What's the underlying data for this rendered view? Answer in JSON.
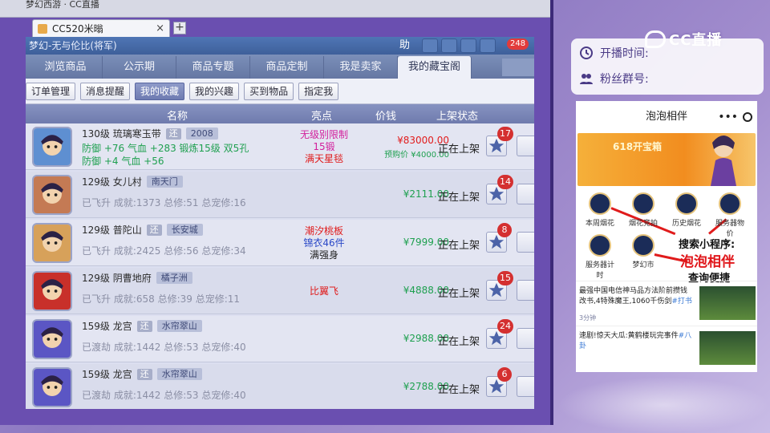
{
  "browser": {
    "top_text": "梦幻西游  ·  CC直播",
    "tab_label": "CC520米暡"
  },
  "app": {
    "title": "梦幻-无与伦比(将军)",
    "help_label": "助",
    "notification_count": "248",
    "nav_tabs": [
      "浏览商品",
      "公示期",
      "商品专题",
      "商品定制",
      "我是卖家",
      "我的藏宝阁"
    ],
    "active_tab_index": 5,
    "sub_buttons": [
      "订单管理",
      "消息提醒",
      "我的收藏",
      "我的兴趣",
      "买到物品",
      "指定我"
    ],
    "active_sub_index": 2,
    "columns": [
      "名称",
      "亮点",
      "价钱",
      "上架状态"
    ]
  },
  "rows": [
    {
      "level_name": "130级  琉璃寒玉带",
      "tag": "还",
      "server": "2008",
      "stats_line1": "防御 +76 气血 +283 锻炼15级 双5孔",
      "stats_line2": "防御 +4 气血 +56",
      "stats_green": true,
      "highlights": [
        {
          "text": "无级别限制",
          "color": "#d21f9c"
        },
        {
          "text": "15锻",
          "color": "#d21f9c"
        },
        {
          "text": "满天星毯",
          "color": "#e01b1b"
        }
      ],
      "price": "¥83000.00",
      "price_red": true,
      "price_sub": "预购价 ¥4000.00",
      "status": "正在上架",
      "fav_count": "17",
      "avatar_color": "#5e8fd1"
    },
    {
      "level_name": "129级  女儿村",
      "tag": "",
      "server": "南天门",
      "stats_line1": "已飞升 成就:1373 总修:51 总宠修:16",
      "stats_line2": "",
      "stats_green": false,
      "highlights": [],
      "price": "¥2111.00",
      "price_red": false,
      "price_sub": "",
      "status": "正在上架",
      "fav_count": "14",
      "avatar_color": "#c47a54"
    },
    {
      "level_name": "129级  普陀山",
      "tag": "还",
      "server": "长安城",
      "stats_line1": "已飞升 成就:2425 总修:56 总宠修:34",
      "stats_line2": "",
      "stats_green": false,
      "highlights": [
        {
          "text": "潮汐桃板",
          "color": "#e01b1b"
        },
        {
          "text": "锦衣46件",
          "color": "#2a48c7"
        },
        {
          "text": "满强身",
          "color": "#222222"
        }
      ],
      "price": "¥7999.00",
      "price_red": false,
      "price_sub": "",
      "status": "正在上架",
      "fav_count": "8",
      "avatar_color": "#d7a15a"
    },
    {
      "level_name": "129级  阴曹地府",
      "tag": "",
      "server": "橘子洲",
      "stats_line1": "已飞升 成就:658 总修:39 总宠修:11",
      "stats_line2": "",
      "stats_green": false,
      "highlights": [
        {
          "text": "比翼飞",
          "color": "#e01b1b"
        }
      ],
      "price": "¥4888.00",
      "price_red": false,
      "price_sub": "",
      "status": "正在上架",
      "fav_count": "15",
      "avatar_color": "#c8302a"
    },
    {
      "level_name": "159级  龙宫",
      "tag": "还",
      "server": "水帘翠山",
      "stats_line1": "已渡劫 成就:1442 总修:53 总宠修:40",
      "stats_line2": "",
      "stats_green": false,
      "highlights": [],
      "price": "¥2988.00",
      "price_red": false,
      "price_sub": "",
      "status": "正在上架",
      "fav_count": "24",
      "avatar_color": "#5b56c4"
    },
    {
      "level_name": "159级  龙宫",
      "tag": "还",
      "server": "水帘翠山",
      "stats_line1": "已渡劫 成就:1442 总修:53 总宠修:40",
      "stats_line2": "",
      "stats_green": false,
      "highlights": [],
      "price": "¥2788.00",
      "price_red": false,
      "price_sub": "",
      "status": "正在上架",
      "fav_count": "6",
      "avatar_color": "#5b56c4"
    }
  ],
  "overlay": {
    "cc_logo": "CC直播",
    "start_time_label": "开播时间:",
    "fan_group_label": "粉丝群号:",
    "promo": {
      "title": "泡泡相伴",
      "banner_text": "618开宝箱",
      "grid_items": [
        "本周烟花",
        "烟花竞拍",
        "历史烟花",
        "服务器物价",
        "服务器计时",
        "梦幻市"
      ],
      "search_hint": "搜索小程序:",
      "app_name": "泡泡相伴",
      "tagline": "查询便捷",
      "news": [
        {
          "text": "最强中国电信神马品方法阶前攒钱改书,4特殊魔王,1060千伤剑",
          "tag": "#打书",
          "meta": "3分钟"
        },
        {
          "text": "速剧!惊天大瓜:黄鹤楼玩完事件",
          "tag": "#八卦",
          "meta": ""
        }
      ]
    }
  },
  "colors": {
    "price_green": "#1fa050",
    "price_red": "#e21c1c",
    "nav_active_bg": "#eef0f8",
    "fav_badge": "#d43030"
  }
}
